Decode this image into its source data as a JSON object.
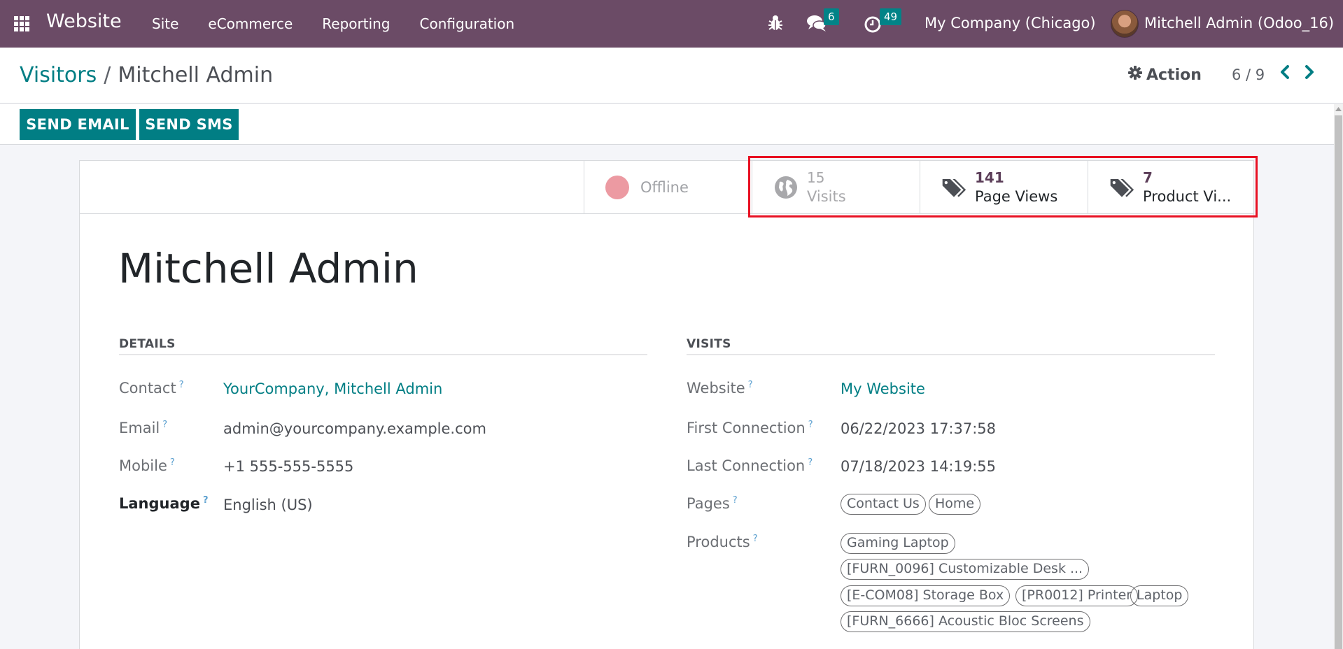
{
  "navbar": {
    "app_name": "Website",
    "menu": [
      "Site",
      "eCommerce",
      "Reporting",
      "Configuration"
    ],
    "icons": {
      "apps": "apps-grid-icon",
      "debug": "bug-icon",
      "messages": "chat-icon",
      "activities": "clock-icon"
    },
    "messages_count": "6",
    "activities_count": "49",
    "company": "My Company (Chicago)",
    "user": "Mitchell Admin (Odoo_16)"
  },
  "control_panel": {
    "breadcrumb_parent": "Visitors",
    "breadcrumb_sep": "/",
    "breadcrumb_current": "Mitchell Admin",
    "action_label": "Action",
    "pager": "6 / 9"
  },
  "buttons": {
    "send_email": "SEND EMAIL",
    "send_sms": "SEND SMS"
  },
  "stats": {
    "status": "Offline",
    "status_color": "#ec9aa2",
    "visits": {
      "value": "15",
      "label": "Visits"
    },
    "page_views": {
      "value": "141",
      "label": "Page Views"
    },
    "product_views": {
      "value": "7",
      "label": "Product Vi..."
    }
  },
  "record": {
    "name": "Mitchell Admin",
    "details": {
      "title": "DETAILS",
      "fields": [
        {
          "label": "Contact",
          "value": "YourCompany, Mitchell Admin"
        },
        {
          "label": "Email",
          "value": "admin@yourcompany.example.com"
        },
        {
          "label": "Mobile",
          "value": "+1 555-555-5555"
        },
        {
          "label": "Language",
          "value": "English (US)"
        }
      ]
    },
    "visits": {
      "title": "VISITS",
      "fields": [
        {
          "label": "Website",
          "value": "My Website"
        },
        {
          "label": "First Connection",
          "value": "06/22/2023 17:37:58"
        },
        {
          "label": "Last Connection",
          "value": "07/18/2023 14:19:55"
        },
        {
          "label": "Pages",
          "value": ""
        },
        {
          "label": "Products",
          "value": ""
        }
      ],
      "pages": [
        "Contact Us",
        "Home"
      ],
      "products": [
        "Gaming Laptop",
        "[FURN_0096] Customizable Desk ...",
        "[E-COM08] Storage Box",
        "[PR0012] Printer",
        "Laptop",
        "[FURN_6666] Acoustic Bloc Screens"
      ]
    },
    "help_marker": "?"
  },
  "colors": {
    "navbar": "#6b4b66",
    "primary": "#017e84",
    "highlight": "#e81123"
  }
}
